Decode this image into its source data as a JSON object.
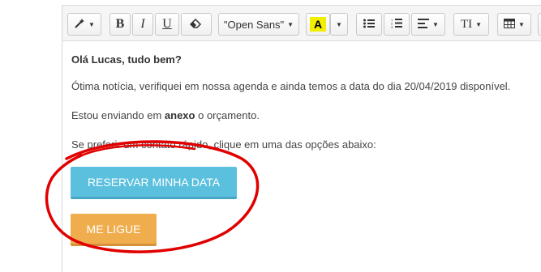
{
  "toolbar": {
    "font_family": "\"Open Sans\"",
    "bold_label": "B",
    "italic_label": "I",
    "underline_label": "U",
    "text_color_label": "A",
    "font_size_label": "TI",
    "icons": [
      "magic-wand-icon",
      "eraser-icon",
      "bullet-list-icon",
      "numbered-list-icon",
      "align-left-icon",
      "table-icon"
    ],
    "highlight_color": "#f2ee00"
  },
  "email": {
    "greeting": "Olá Lucas,  tudo bem?",
    "paragraph1": "Ótima notícia, verifiquei em nossa agenda e ainda temos a data do dia 20/04/2019 disponível.",
    "paragraph2_before": "Estou enviando em ",
    "paragraph2_bold": "anexo",
    "paragraph2_after": " o orçamento.",
    "paragraph3": "Se preferir um contato rápido, clique em uma das opções abaixo:",
    "buttons": {
      "reserve": {
        "label": "RESERVAR MINHA DATA",
        "color": "#5bc0de"
      },
      "call": {
        "label": "ME LIGUE",
        "color": "#f0ad4e"
      }
    }
  },
  "annotation": {
    "type": "hand-drawn ellipse",
    "color": "#e00000"
  }
}
